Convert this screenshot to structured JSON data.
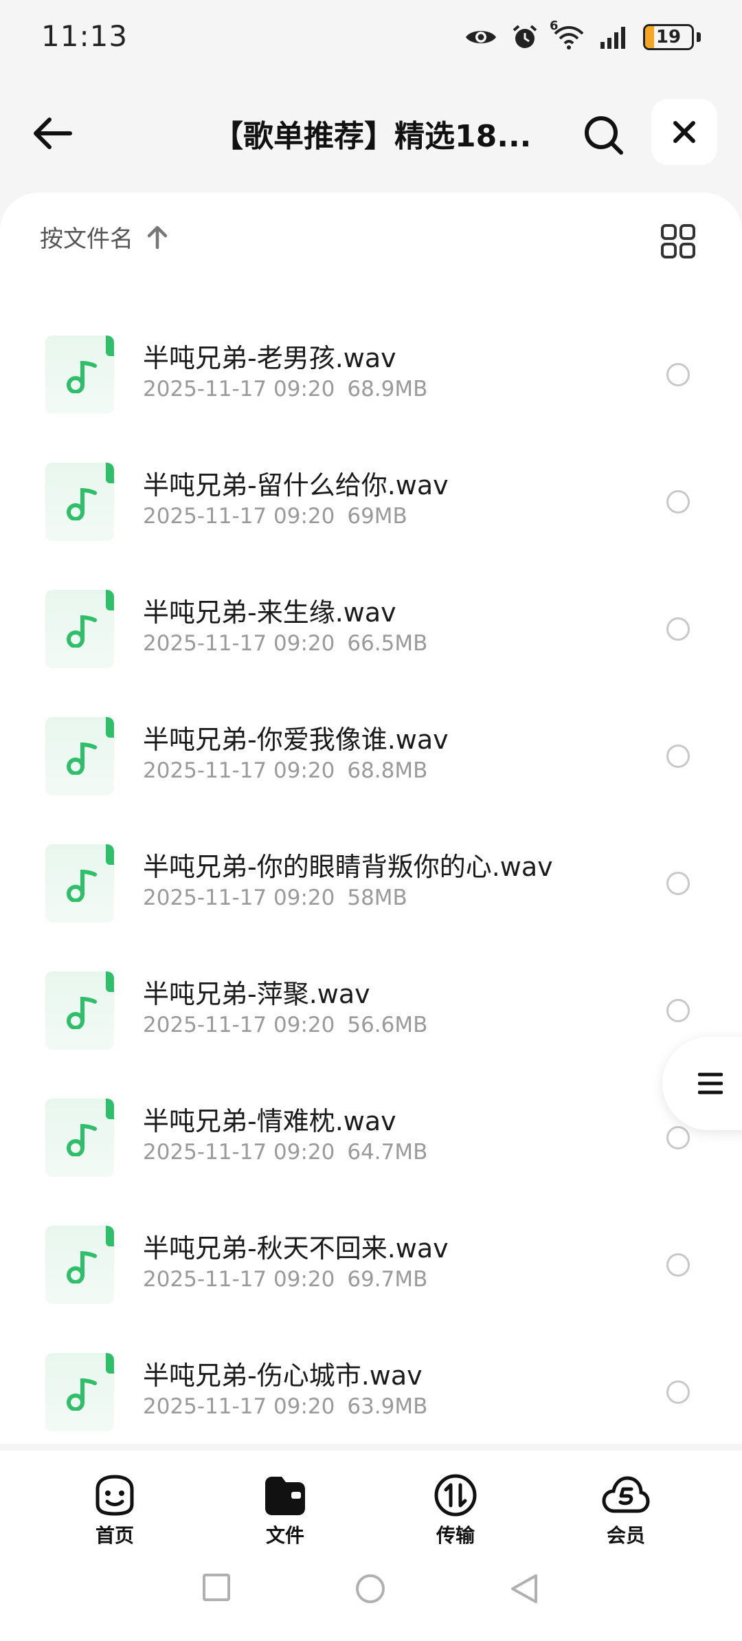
{
  "status_bar": {
    "time": "11:13",
    "network_badge": "6",
    "battery_level": "19",
    "battery_fraction": 0.19,
    "battery_color": "#f5a623"
  },
  "header": {
    "title": "【歌单推荐】精选18...",
    "back_icon": "arrow-left-icon",
    "search_icon": "search-icon",
    "close_icon": "close-icon"
  },
  "sort": {
    "label": "按文件名",
    "direction_icon": "arrow-up-icon"
  },
  "view_toggle_icon": "grid-view-icon",
  "files": [
    {
      "name": "半吨兄弟-老男孩.wav",
      "date": "2025-11-17 09:20",
      "size": "68.9MB"
    },
    {
      "name": "半吨兄弟-留什么给你.wav",
      "date": "2025-11-17 09:20",
      "size": "69MB"
    },
    {
      "name": "半吨兄弟-来生缘.wav",
      "date": "2025-11-17 09:20",
      "size": "66.5MB"
    },
    {
      "name": "半吨兄弟-你爱我像谁.wav",
      "date": "2025-11-17 09:20",
      "size": "68.8MB"
    },
    {
      "name": "半吨兄弟-你的眼睛背叛你的心.wav",
      "date": "2025-11-17 09:20",
      "size": "58MB"
    },
    {
      "name": "半吨兄弟-萍聚.wav",
      "date": "2025-11-17 09:20",
      "size": "56.6MB"
    },
    {
      "name": "半吨兄弟-情难枕.wav",
      "date": "2025-11-17 09:20",
      "size": "64.7MB"
    },
    {
      "name": "半吨兄弟-秋天不回来.wav",
      "date": "2025-11-17 09:20",
      "size": "69.7MB"
    },
    {
      "name": "半吨兄弟-伤心城市.wav",
      "date": "2025-11-17 09:20",
      "size": "63.9MB"
    }
  ],
  "file_icon": "music-file-icon",
  "accent_color": "#2fbf6a",
  "bottom_nav": [
    {
      "label": "首页",
      "icon": "smiley-home-icon"
    },
    {
      "label": "文件",
      "icon": "folder-icon"
    },
    {
      "label": "传输",
      "icon": "transfer-icon"
    },
    {
      "label": "会员",
      "icon": "cloud-member-icon"
    }
  ]
}
